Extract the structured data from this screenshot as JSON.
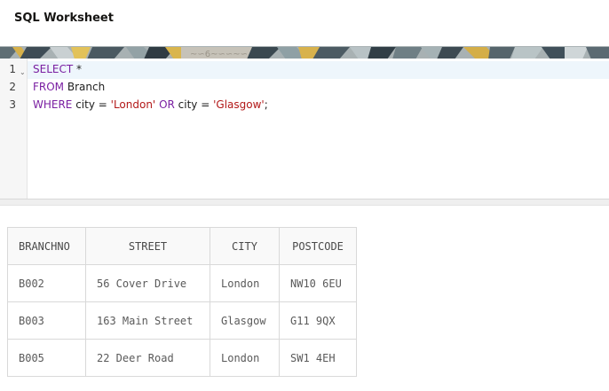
{
  "worksheet": {
    "title": "SQL Worksheet"
  },
  "editor": {
    "lines": [
      {
        "number": "1",
        "tokens": [
          {
            "text": "SELECT",
            "kind": "kw"
          },
          {
            "text": " *",
            "kind": "plain"
          }
        ]
      },
      {
        "number": "2",
        "tokens": [
          {
            "text": "FROM",
            "kind": "kw"
          },
          {
            "text": " Branch",
            "kind": "plain"
          }
        ]
      },
      {
        "number": "3",
        "tokens": [
          {
            "text": "WHERE",
            "kind": "kw"
          },
          {
            "text": " city = ",
            "kind": "plain"
          },
          {
            "text": "'London'",
            "kind": "str"
          },
          {
            "text": " ",
            "kind": "plain"
          },
          {
            "text": "OR",
            "kind": "kw"
          },
          {
            "text": " city = ",
            "kind": "plain"
          },
          {
            "text": "'Glasgow'",
            "kind": "str"
          },
          {
            "text": ";",
            "kind": "plain"
          }
        ]
      }
    ],
    "fold_icon": "chevron-down-icon",
    "colors": {
      "keyword": "#7a1fa2",
      "string": "#b21818",
      "active_line": "#eef6fc"
    }
  },
  "results": {
    "columns": [
      "BRANCHNO",
      "STREET",
      "CITY",
      "POSTCODE"
    ],
    "rows": [
      [
        "B002",
        "56 Cover Drive",
        "London",
        "NW10 6EU"
      ],
      [
        "B003",
        "163 Main Street",
        "Glasgow",
        "G11 9QX"
      ],
      [
        "B005",
        "22 Deer Road",
        "London",
        "SW1 4EH"
      ]
    ]
  }
}
